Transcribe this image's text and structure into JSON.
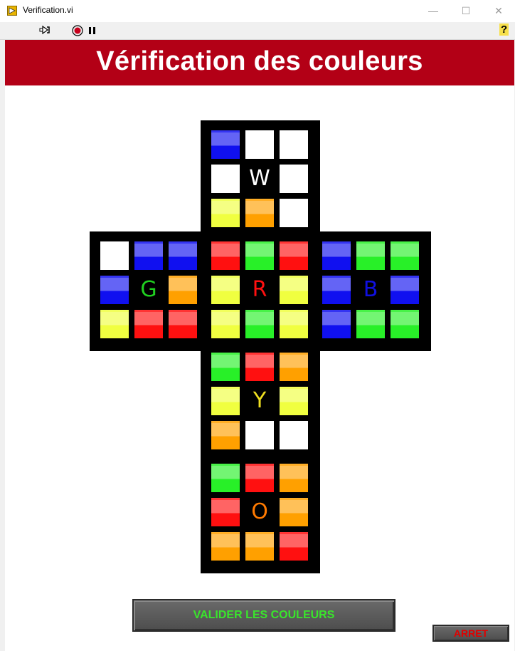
{
  "window": {
    "title": "Verification.vi",
    "min_glyph": "—",
    "max_glyph": "☐",
    "close_glyph": "✕"
  },
  "toolbar": {
    "help_glyph": "?"
  },
  "banner": {
    "title": "Vérification des couleurs"
  },
  "colors": {
    "W": "#ffffff",
    "Y": "#f0ff40",
    "O": "#ffa000",
    "R": "#ff1010",
    "G": "#28f028",
    "B": "#1010f0"
  },
  "faces": [
    {
      "id": "white",
      "center_label": "W",
      "label_color": "#ffffff",
      "tiles": [
        "B",
        "W",
        "W",
        "W",
        "W",
        "W",
        "Y",
        "O",
        "W"
      ]
    },
    {
      "id": "green",
      "center_label": "G",
      "label_color": "#20d020",
      "tiles": [
        "W",
        "B",
        "B",
        "B",
        "G",
        "O",
        "Y",
        "R",
        "R"
      ]
    },
    {
      "id": "red",
      "center_label": "R",
      "label_color": "#ff1010",
      "tiles": [
        "R",
        "G",
        "R",
        "Y",
        "R",
        "Y",
        "Y",
        "G",
        "Y"
      ]
    },
    {
      "id": "blue",
      "center_label": "B",
      "label_color": "#1010e0",
      "tiles": [
        "B",
        "G",
        "G",
        "B",
        "B",
        "B",
        "B",
        "G",
        "G"
      ]
    },
    {
      "id": "yellow",
      "center_label": "Y",
      "label_color": "#f0e020",
      "tiles": [
        "G",
        "R",
        "O",
        "Y",
        "Y",
        "Y",
        "O",
        "W",
        "W"
      ]
    },
    {
      "id": "orange",
      "center_label": "O",
      "label_color": "#ff7a00",
      "tiles": [
        "G",
        "R",
        "O",
        "R",
        "O",
        "O",
        "O",
        "O",
        "R"
      ]
    }
  ],
  "buttons": {
    "validate_label": "VALIDER LES COULEURS",
    "stop_label": "ARRET"
  }
}
